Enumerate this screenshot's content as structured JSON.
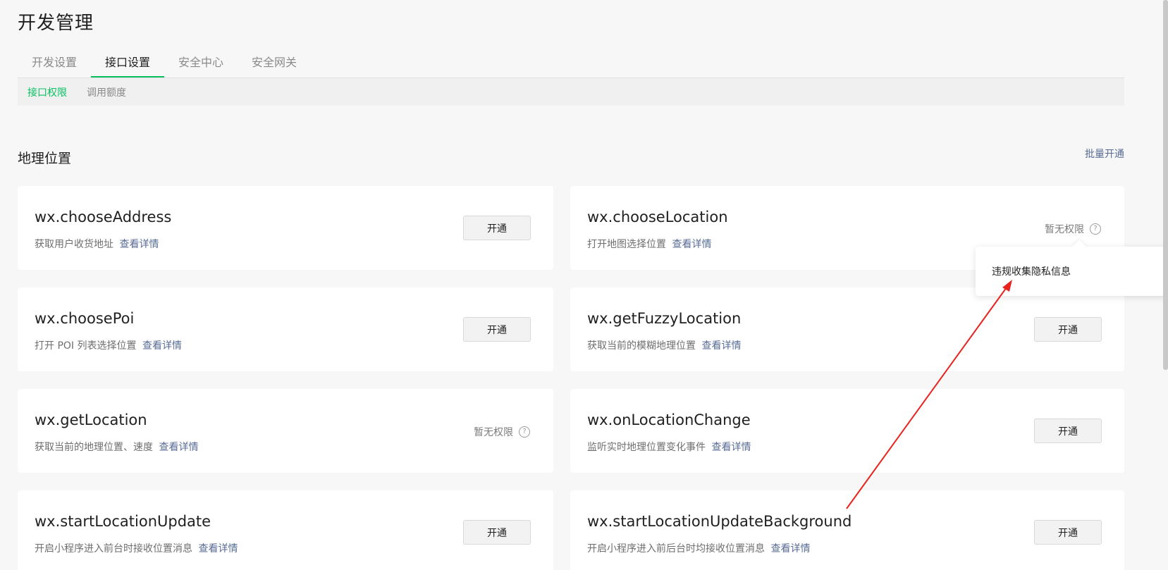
{
  "page": {
    "title": "开发管理"
  },
  "tabs": [
    {
      "label": "开发设置",
      "active": false
    },
    {
      "label": "接口设置",
      "active": true
    },
    {
      "label": "安全中心",
      "active": false
    },
    {
      "label": "安全网关",
      "active": false
    }
  ],
  "subtabs": [
    {
      "label": "接口权限",
      "active": true
    },
    {
      "label": "调用额度",
      "active": false
    }
  ],
  "section": {
    "title": "地理位置",
    "batch_label": "批量开通"
  },
  "common": {
    "detail_link": "查看详情",
    "open_label": "开通",
    "no_permission": "暂无权限",
    "help_glyph": "?"
  },
  "apis": [
    {
      "name": "wx.chooseAddress",
      "desc": "获取用户收货地址",
      "status": "open"
    },
    {
      "name": "wx.chooseLocation",
      "desc": "打开地图选择位置",
      "status": "no_permission"
    },
    {
      "name": "wx.choosePoi",
      "desc": "打开 POI 列表选择位置",
      "status": "open"
    },
    {
      "name": "wx.getFuzzyLocation",
      "desc": "获取当前的模糊地理位置",
      "status": "open"
    },
    {
      "name": "wx.getLocation",
      "desc": "获取当前的地理位置、速度",
      "status": "no_permission"
    },
    {
      "name": "wx.onLocationChange",
      "desc": "监听实时地理位置变化事件",
      "status": "open"
    },
    {
      "name": "wx.startLocationUpdate",
      "desc": "开启小程序进入前台时接收位置消息",
      "status": "open"
    },
    {
      "name": "wx.startLocationUpdateBackground",
      "desc": "开启小程序进入前后台时均接收位置消息",
      "status": "open"
    }
  ],
  "tooltip": {
    "text": "违规收集隐私信息"
  },
  "colors": {
    "accent": "#07c160",
    "link": "#576b95",
    "annotation": "#e8231e"
  }
}
